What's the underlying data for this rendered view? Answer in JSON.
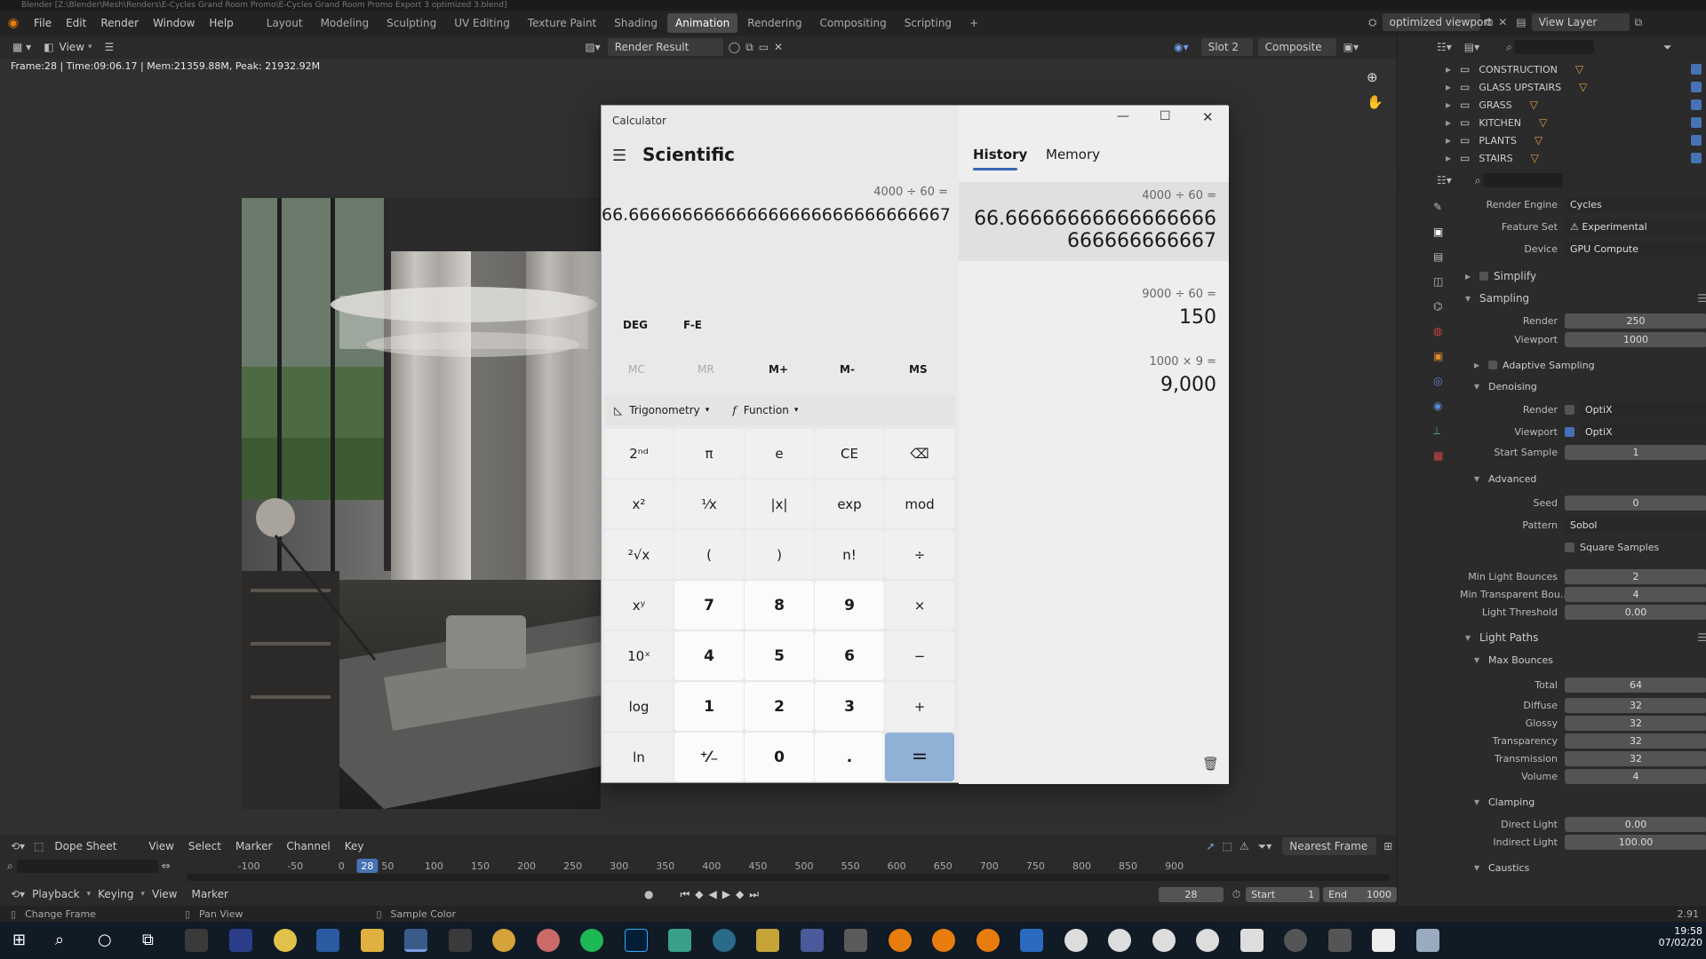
{
  "window_title": "Blender [Z:\\Blender\\Mesh\\Renders\\E-Cycles Grand Room Promo\\E-Cycles Grand Room Promo Export 3 optimized 3.blend]",
  "menu": [
    "File",
    "Edit",
    "Render",
    "Window",
    "Help"
  ],
  "workspaces": [
    "Layout",
    "Modeling",
    "Sculpting",
    "UV Editing",
    "Texture Paint",
    "Shading",
    "Animation",
    "Rendering",
    "Compositing",
    "Scripting"
  ],
  "active_workspace": "Animation",
  "scene_name": "optimized viewport",
  "view_layer": "View Layer",
  "image_editor": {
    "view_label": "View",
    "image_name": "Render Result",
    "slot": "Slot 2",
    "layer": "Composite",
    "stats": "Frame:28 | Time:09:06.17 | Mem:21359.88M, Peak: 21932.92M"
  },
  "outliner": [
    "CONSTRUCTION",
    "GLASS UPSTAIRS",
    "GRASS",
    "KITCHEN",
    "PLANTS",
    "STAIRS"
  ],
  "properties": {
    "render_engine_label": "Render Engine",
    "render_engine": "Cycles",
    "feature_set_label": "Feature Set",
    "feature_set": "Experimental",
    "device_label": "Device",
    "device": "GPU Compute",
    "simplify": "Simplify",
    "sampling": "Sampling",
    "render_label": "Render",
    "render_samples": "250",
    "viewport_label": "Viewport",
    "viewport_samples": "1000",
    "adaptive": "Adaptive Sampling",
    "denoising": "Denoising",
    "den_render_label": "Render",
    "den_render": "OptiX",
    "den_viewport_label": "Viewport",
    "den_viewport": "OptiX",
    "start_sample_label": "Start Sample",
    "start_sample": "1",
    "advanced": "Advanced",
    "seed_label": "Seed",
    "seed": "0",
    "pattern_label": "Pattern",
    "pattern": "Sobol",
    "square_samples": "Square Samples",
    "min_light_label": "Min Light Bounces",
    "min_light": "2",
    "min_trans_label": "Min Transparent Bou...",
    "min_trans": "4",
    "light_threshold_label": "Light Threshold",
    "light_threshold": "0.00",
    "light_paths": "Light Paths",
    "max_bounces": "Max Bounces",
    "total_label": "Total",
    "total": "64",
    "diffuse_label": "Diffuse",
    "diffuse": "32",
    "glossy_label": "Glossy",
    "glossy": "32",
    "transparency_label": "Transparency",
    "transparency": "32",
    "transmission_label": "Transmission",
    "transmission": "32",
    "volume_label": "Volume",
    "volume": "4",
    "clamping": "Clamping",
    "direct_label": "Direct Light",
    "direct": "0.00",
    "indirect_label": "Indirect Light",
    "indirect": "100.00",
    "caustics": "Caustics"
  },
  "timeline": {
    "editor": "Dope Sheet",
    "menus": [
      "View",
      "Select",
      "Marker",
      "Channel",
      "Key"
    ],
    "snap": "Nearest Frame",
    "ticks": [
      "-100",
      "-50",
      "0",
      "28",
      "50",
      "100",
      "150",
      "200",
      "250",
      "300",
      "350",
      "400",
      "450",
      "500",
      "550",
      "600",
      "650",
      "700",
      "750",
      "800",
      "850",
      "900"
    ],
    "current_frame": 28,
    "current_frame_text": "28",
    "playback": "Playback",
    "keying": "Keying",
    "view": "View",
    "marker": "Marker",
    "start_label": "Start",
    "start": "1",
    "end_label": "End",
    "end": "1000"
  },
  "status": {
    "change_frame": "Change Frame",
    "pan_view": "Pan View",
    "sample_color": "Sample Color",
    "version": "2.91"
  },
  "calculator": {
    "app_title": "Calculator",
    "mode": "Scientific",
    "tab_history": "History",
    "tab_memory": "Memory",
    "expression": "4000 ÷ 60 =",
    "display": "66.666666666666666666666666666667",
    "deg": "DEG",
    "fe": "F-E",
    "memory_keys": [
      "MC",
      "MR",
      "M+",
      "M-",
      "MS"
    ],
    "trig": "Trigonometry",
    "func": "Function",
    "keys": [
      [
        "2ⁿᵈ",
        "π",
        "e",
        "CE",
        "⌫"
      ],
      [
        "x²",
        "¹⁄x",
        "|x|",
        "exp",
        "mod"
      ],
      [
        "²√x",
        "(",
        ")",
        "n!",
        "÷"
      ],
      [
        "xʸ",
        "7",
        "8",
        "9",
        "×"
      ],
      [
        "10ˣ",
        "4",
        "5",
        "6",
        "−"
      ],
      [
        "log",
        "1",
        "2",
        "3",
        "+"
      ],
      [
        "ln",
        "⁺⁄₋",
        "0",
        ".",
        "="
      ]
    ],
    "history": [
      {
        "expr": "4000  ÷  60 =",
        "result1": "66.66666666666666666",
        "result2": "666666666667"
      },
      {
        "expr": "9000  ÷  60 =",
        "result1": "150",
        "result2": ""
      },
      {
        "expr": "1000  ×  9 =",
        "result1": "9,000",
        "result2": ""
      }
    ]
  },
  "clock": {
    "time": "19:58",
    "date": "07/02/20"
  },
  "colors": {
    "accent": "#4772b3",
    "calc_eq": "#8fb1d6",
    "timeline_current": "#4772b3"
  }
}
